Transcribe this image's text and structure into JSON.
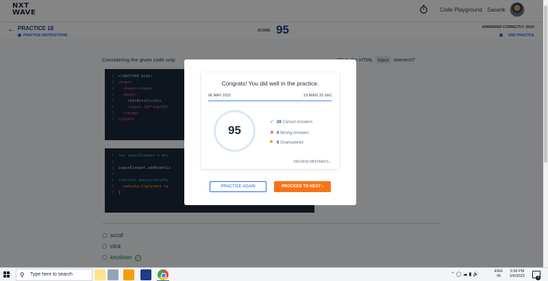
{
  "navbar": {
    "logo_line1": "NXT",
    "logo_line2": "WAVE",
    "code_playground": "Code Playground",
    "user_name": "Sasank"
  },
  "practice_header": {
    "title": "PRACTICE 18",
    "instructions_link": "PRACTICE INSTRUCTIONS",
    "score_label": "SCORE:",
    "score_value": "95",
    "answered_correctly": "ANSWERED CORRECTLY: 20/20",
    "end_practice": "END PRACTICE"
  },
  "question": {
    "text_before": "Considering the given code snip",
    "text_after_tail": "\"Z\" in the HTML",
    "tag": "input",
    "text_end": "element?"
  },
  "code_block_1": [
    {
      "n": "1",
      "text": "<!DOCTYPE html>"
    },
    {
      "n": "2",
      "text": "<html>"
    },
    {
      "n": "3",
      "text": "  <head></head>"
    },
    {
      "n": "4",
      "text": "  <body>"
    },
    {
      "n": "5",
      "text": "    <h1>Enroll</h1>"
    },
    {
      "n": "6",
      "text": "    <input id=\"inputEl"
    },
    {
      "n": "7",
      "text": "  </body>"
    },
    {
      "n": "8",
      "text": "</html>"
    }
  ],
  "code_block_2": [
    {
      "n": "1",
      "text": "let inputElement = doc"
    },
    {
      "n": "2",
      "text": ""
    },
    {
      "n": "3",
      "text": "inputElement.addEventLi"
    },
    {
      "n": "4",
      "text": ""
    },
    {
      "n": "5",
      "text": "function manipulateSty"
    },
    {
      "n": "6",
      "text": "  console.log(event.ty"
    },
    {
      "n": "7",
      "text": "}"
    }
  ],
  "options": [
    {
      "label": "scroll"
    },
    {
      "label": "click"
    },
    {
      "label": "keydown",
      "correct": true
    }
  ],
  "modal": {
    "heading": "Congrats! You did well in the practice.",
    "date": "06 MAY 2023",
    "duration": "23 MINS 25 SEC",
    "score": "95",
    "correct_count": "20",
    "correct_label": "Correct Answers",
    "wrong_count": "0",
    "wrong_label": "Wrong Answers",
    "unanswered_count": "0",
    "unanswered_label": "Unanswered",
    "review_mistakes": "REVIEW MISTAKES",
    "practice_again": "PRACTICE AGAIN",
    "proceed_next": "PROCEED TO NEXT"
  },
  "taskbar": {
    "search_placeholder": "Type here to search",
    "lang_line1": "ENG",
    "lang_line2": "IN",
    "time": "5:56 PM",
    "date": "5/6/2023",
    "notifications": "3"
  },
  "colors": {
    "accent_blue": "#1e3a8a",
    "link_blue": "#2563eb",
    "orange": "#f97316",
    "success": "#16a34a",
    "error": "#dc2626",
    "warning": "#f59e0b"
  }
}
